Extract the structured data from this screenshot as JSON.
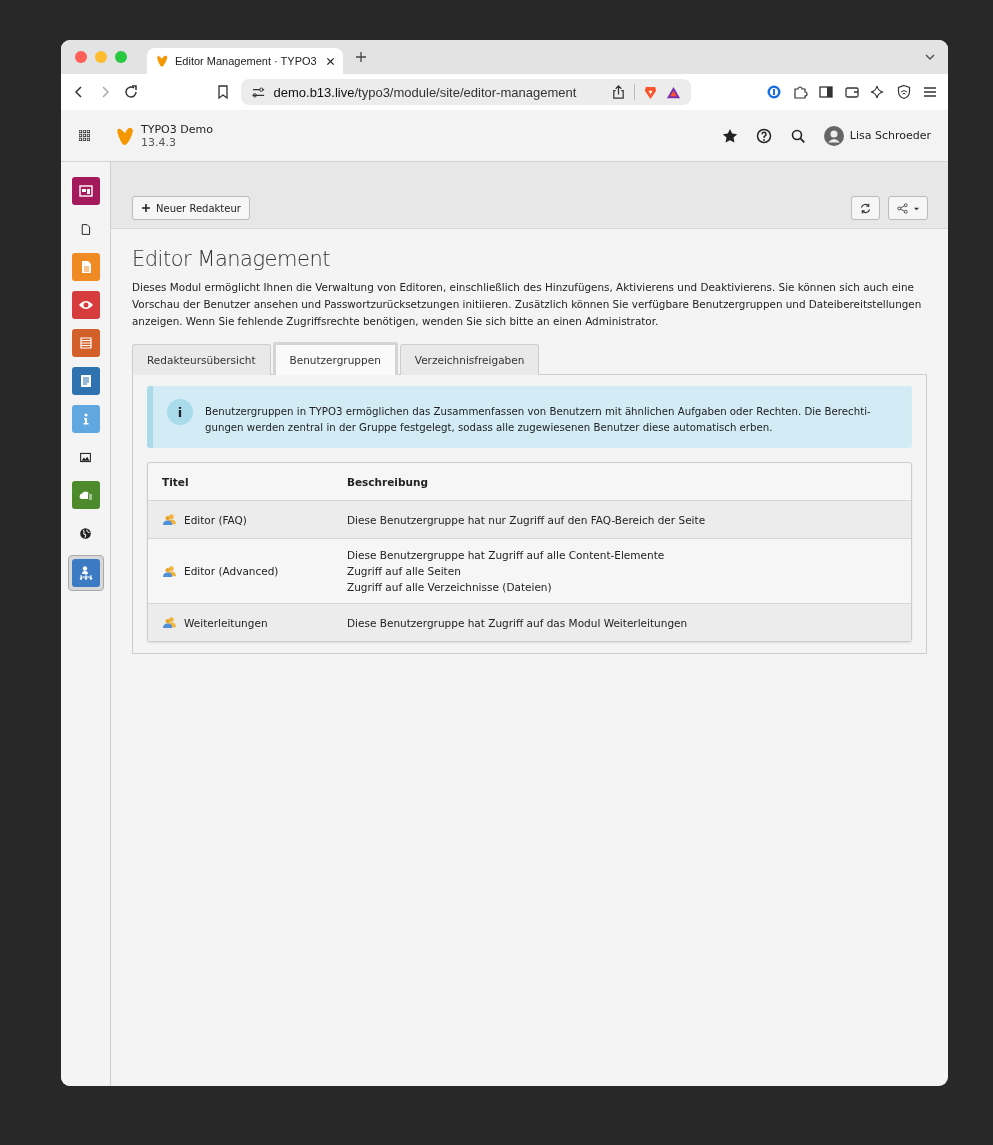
{
  "browser": {
    "tab_title": "Editor Management · TYPO3",
    "url_host": "demo.b13.live",
    "url_path": "/typo3/module/site/editor-management"
  },
  "topbar": {
    "site_name": "TYPO3 Demo",
    "version": "13.4.3",
    "user": "Lisa Schroeder"
  },
  "modules": [
    {
      "kind": "tile",
      "color": "#a3195b",
      "selected": false
    },
    {
      "kind": "plain",
      "selected": false
    },
    {
      "kind": "tile",
      "color": "#f08a24",
      "selected": false
    },
    {
      "kind": "tile",
      "color": "#d63c3c",
      "selected": false
    },
    {
      "kind": "tile",
      "color": "#d3602a",
      "selected": false
    },
    {
      "kind": "tile",
      "color": "#2f72b0",
      "selected": false
    },
    {
      "kind": "tile",
      "color": "#62a8e0",
      "selected": false
    },
    {
      "kind": "plain",
      "selected": false
    },
    {
      "kind": "tile",
      "color": "#4c8a2c",
      "selected": false
    },
    {
      "kind": "plain",
      "selected": false
    },
    {
      "kind": "tile",
      "color": "#3d7ac4",
      "selected": true
    }
  ],
  "docheader": {
    "new_button": "Neuer Redakteur"
  },
  "page": {
    "title": "Editor Management",
    "intro": "Dieses Modul ermöglicht Ihnen die Verwaltung von Editoren, einschließlich des Hinzufügens, Aktivierens und Deaktivierens. Sie können sich auch eine Vorschau der Benutzer ansehen und Passwortzurücksetzungen initiieren. Zusätzlich können Sie verfügbare Benutzergruppen und Dateibereitstellungen anzeigen. Wenn Sie fehlende Zugriffsrechte benötigen, wenden Sie sich bitte an einen Administrator."
  },
  "tabs": [
    {
      "label": "Redakteursübersicht",
      "selected": false
    },
    {
      "label": "Benutzergruppen",
      "selected": true
    },
    {
      "label": "Verzeichnisfreigaben",
      "selected": false
    }
  ],
  "callout": {
    "icon": "i",
    "text": "Benutzergruppen in TYPO3 ermöglichen das Zusammenfassen von Benutzern mit ähnlichen Aufgaben oder Rechten. Die Berechti-gungen werden zentral in der Gruppe festgelegt, sodass alle zugewiesenen Benutzer diese automatisch erben."
  },
  "table": {
    "columns": [
      "Titel",
      "Beschreibung"
    ],
    "rows": [
      {
        "title": "Editor (FAQ)",
        "description": [
          "Diese Benutzergruppe hat nur Zugriff auf den FAQ-Bereich der Seite"
        ]
      },
      {
        "title": "Editor (Advanced)",
        "description": [
          "Diese Benutzergruppe hat Zugriff auf alle Content-Elemente",
          "Zugriff auf alle Seiten",
          "Zugriff auf alle Verzeichnisse (Dateien)"
        ]
      },
      {
        "title": "Weiterleitungen",
        "description": [
          "Diese Benutzergruppe hat Zugriff auf das Modul Weiterleitungen"
        ]
      }
    ]
  }
}
